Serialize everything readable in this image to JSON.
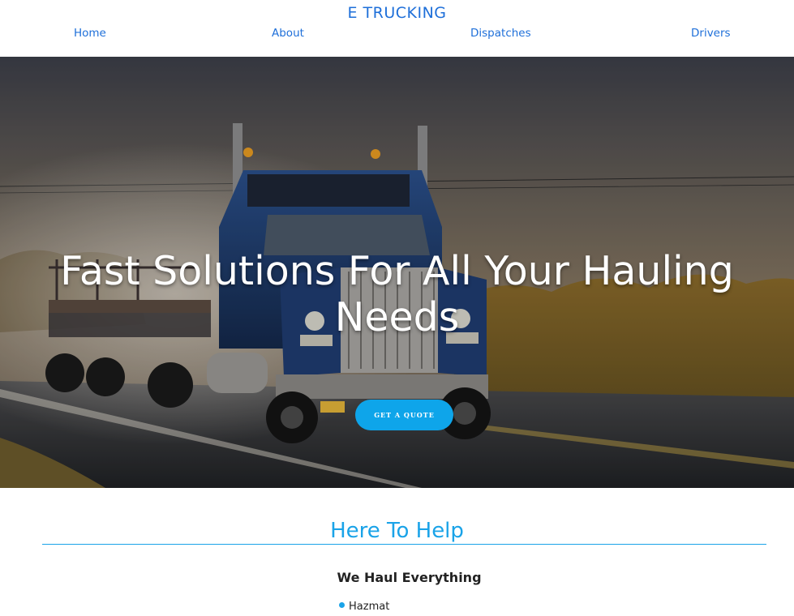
{
  "header": {
    "brand": "E TRUCKING",
    "nav": [
      {
        "label": "Home"
      },
      {
        "label": "About"
      },
      {
        "label": "Dispatches"
      },
      {
        "label": "Drivers"
      }
    ]
  },
  "hero": {
    "title": "Fast Solutions For All Your Hauling Needs",
    "button_label": "GET A QUOTE",
    "image_subject": "semi-truck-on-wet-road"
  },
  "help_section": {
    "title": "Here To Help",
    "subtitle": "We Haul Everything",
    "items": [
      {
        "label": "Hazmat"
      }
    ]
  },
  "colors": {
    "link": "#1e6fd9",
    "accent": "#1aa3e8",
    "button": "#0ea5ea",
    "text": "#222222"
  }
}
